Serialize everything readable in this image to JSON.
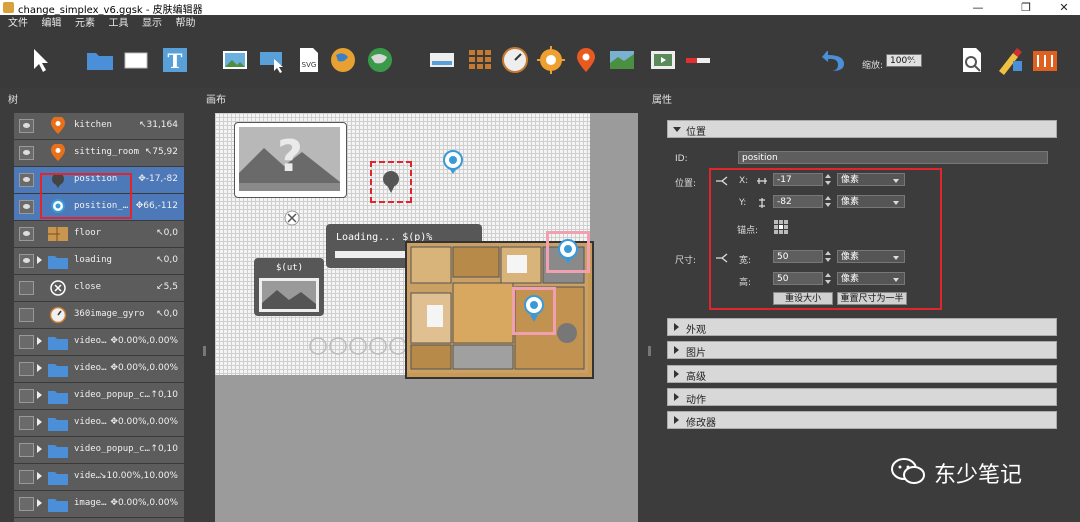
{
  "window": {
    "title": "change_simplex_v6.ggsk - 皮肤编辑器",
    "minimize": "—",
    "maximize": "❐",
    "close": "✕"
  },
  "menu": [
    "文件",
    "编辑",
    "元素",
    "工具",
    "显示",
    "帮助"
  ],
  "toolbar": {
    "zoom_label": "缩放:",
    "zoom_value": "100%"
  },
  "panels": {
    "tree": "树",
    "canvas": "画布",
    "properties": "属性"
  },
  "tree": [
    {
      "name": "kitchen",
      "value": "↖31,164",
      "visible": true,
      "expand": false,
      "icon": "map-pin-icon",
      "selected": false
    },
    {
      "name": "sitting_room",
      "value": "↖75,92",
      "visible": true,
      "expand": false,
      "icon": "map-pin-icon",
      "selected": false
    },
    {
      "name": "position",
      "value": "✥-17,-82",
      "visible": true,
      "expand": false,
      "icon": "marker-icon",
      "selected": true
    },
    {
      "name": "position_…",
      "value": "✥66,-112",
      "visible": true,
      "expand": false,
      "icon": "target-pin-icon",
      "selected": true
    },
    {
      "name": "floor",
      "value": "↖0,0",
      "visible": true,
      "expand": false,
      "icon": "floorplan-icon",
      "selected": false
    },
    {
      "name": "loading",
      "value": "↖0,0",
      "visible": true,
      "expand": true,
      "icon": "folder-icon",
      "selected": false
    },
    {
      "name": "close",
      "value": "↙5,5",
      "visible": false,
      "expand": false,
      "icon": "close-circle-icon",
      "selected": false
    },
    {
      "name": "360image_gyro",
      "value": "↖0,0",
      "visible": false,
      "expand": false,
      "icon": "gyro-icon",
      "selected": false
    },
    {
      "name": "video…",
      "value": "✥0.00%,0.00%",
      "visible": false,
      "expand": true,
      "icon": "folder-icon",
      "selected": false
    },
    {
      "name": "video…",
      "value": "✥0.00%,0.00%",
      "visible": false,
      "expand": true,
      "icon": "folder-icon",
      "selected": false
    },
    {
      "name": "video_popup_c…",
      "value": "↑0,10",
      "visible": false,
      "expand": true,
      "icon": "folder-icon",
      "selected": false
    },
    {
      "name": "video…",
      "value": "✥0.00%,0.00%",
      "visible": false,
      "expand": true,
      "icon": "folder-icon",
      "selected": false
    },
    {
      "name": "video_popup_c…",
      "value": "↑0,10",
      "visible": false,
      "expand": true,
      "icon": "folder-icon",
      "selected": false
    },
    {
      "name": "vide…",
      "value": "↘10.00%,10.00%",
      "visible": false,
      "expand": true,
      "icon": "folder-icon",
      "selected": false
    },
    {
      "name": "image…",
      "value": "✥0.00%,0.00%",
      "visible": false,
      "expand": true,
      "icon": "folder-icon",
      "selected": false
    }
  ],
  "canvas": {
    "loading_text": "Loading... $(p)%",
    "ut_text": "$(ut)"
  },
  "properties": {
    "position_section": "位置",
    "id_label": "ID:",
    "id_value": "position",
    "position_label": "位置:",
    "x_label": "X:",
    "x_value": "-17",
    "y_label": "Y:",
    "y_value": "-82",
    "unit": "像素",
    "anchor_label": "锚点:",
    "size_label": "尺寸:",
    "width_label": "宽:",
    "width_value": "50",
    "height_label": "高:",
    "height_value": "50",
    "reset_size": "重设大小",
    "half_size": "重置尺寸为一半",
    "sections": [
      "外观",
      "图片",
      "高级",
      "动作",
      "修改器"
    ]
  },
  "watermark": "东少笔记",
  "colors": {
    "accent_red": "#e0262c",
    "selection_blue": "#4d79b8"
  }
}
